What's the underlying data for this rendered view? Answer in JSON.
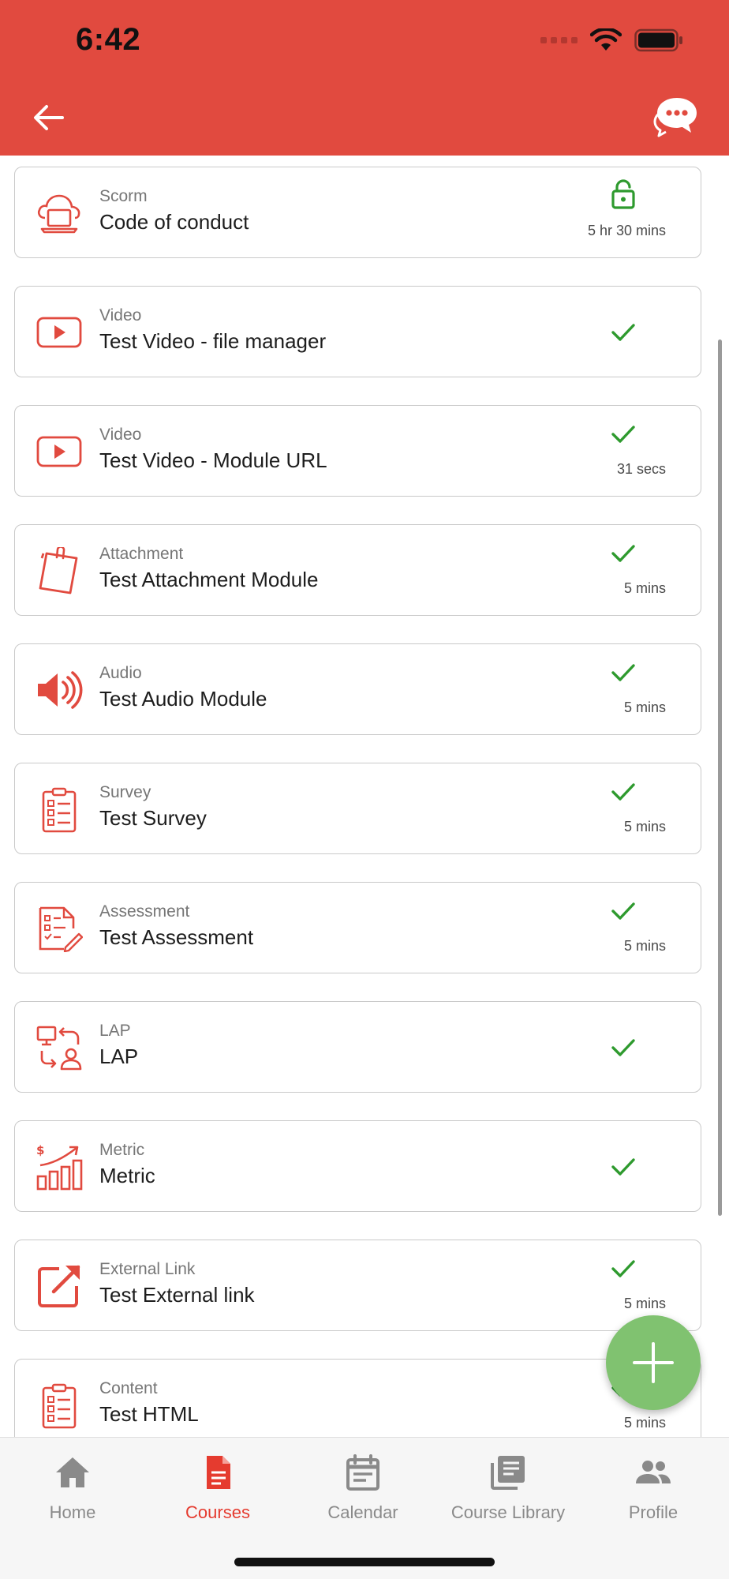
{
  "status_bar": {
    "time": "6:42"
  },
  "colors": {
    "brand": "#e14a3f",
    "success": "#2e9a2e",
    "fab": "#80c270",
    "nav_active": "#e53b2f",
    "nav_inactive": "#8a8a8a"
  },
  "modules": [
    {
      "icon": "cloud-laptop-icon",
      "type": "Scorm",
      "title": "Code of conduct",
      "status": "unlocked",
      "duration": "5 hr 30 mins"
    },
    {
      "icon": "video-play-icon",
      "type": "Video",
      "title": "Test Video - file manager",
      "status": "completed",
      "duration": ""
    },
    {
      "icon": "video-play-icon",
      "type": "Video",
      "title": "Test Video - Module URL",
      "status": "completed",
      "duration": "31 secs"
    },
    {
      "icon": "clipboard-attachment-icon",
      "type": "Attachment",
      "title": "Test Attachment Module",
      "status": "completed",
      "duration": "5 mins"
    },
    {
      "icon": "speaker-icon",
      "type": "Audio",
      "title": "Test Audio Module",
      "status": "completed",
      "duration": "5 mins"
    },
    {
      "icon": "checklist-icon",
      "type": "Survey",
      "title": "Test Survey",
      "status": "completed",
      "duration": "5 mins"
    },
    {
      "icon": "assessment-form-icon",
      "type": "Assessment",
      "title": "Test Assessment",
      "status": "completed",
      "duration": "5 mins"
    },
    {
      "icon": "lap-exchange-icon",
      "type": "LAP",
      "title": "LAP",
      "status": "completed",
      "duration": ""
    },
    {
      "icon": "growth-chart-icon",
      "type": "Metric",
      "title": "Metric",
      "status": "completed",
      "duration": ""
    },
    {
      "icon": "external-link-icon",
      "type": "External Link",
      "title": "Test External link",
      "status": "completed",
      "duration": "5 mins"
    },
    {
      "icon": "checklist-icon",
      "type": "Content",
      "title": "Test HTML",
      "status": "completed",
      "duration": "5 mins"
    }
  ],
  "bottom_nav": {
    "items": [
      {
        "label": "Home",
        "icon": "home-icon",
        "active": false
      },
      {
        "label": "Courses",
        "icon": "document-icon",
        "active": true
      },
      {
        "label": "Calendar",
        "icon": "calendar-icon",
        "active": false
      },
      {
        "label": "Course Library",
        "icon": "library-icon",
        "active": false
      },
      {
        "label": "Profile",
        "icon": "people-icon",
        "active": false
      }
    ]
  }
}
